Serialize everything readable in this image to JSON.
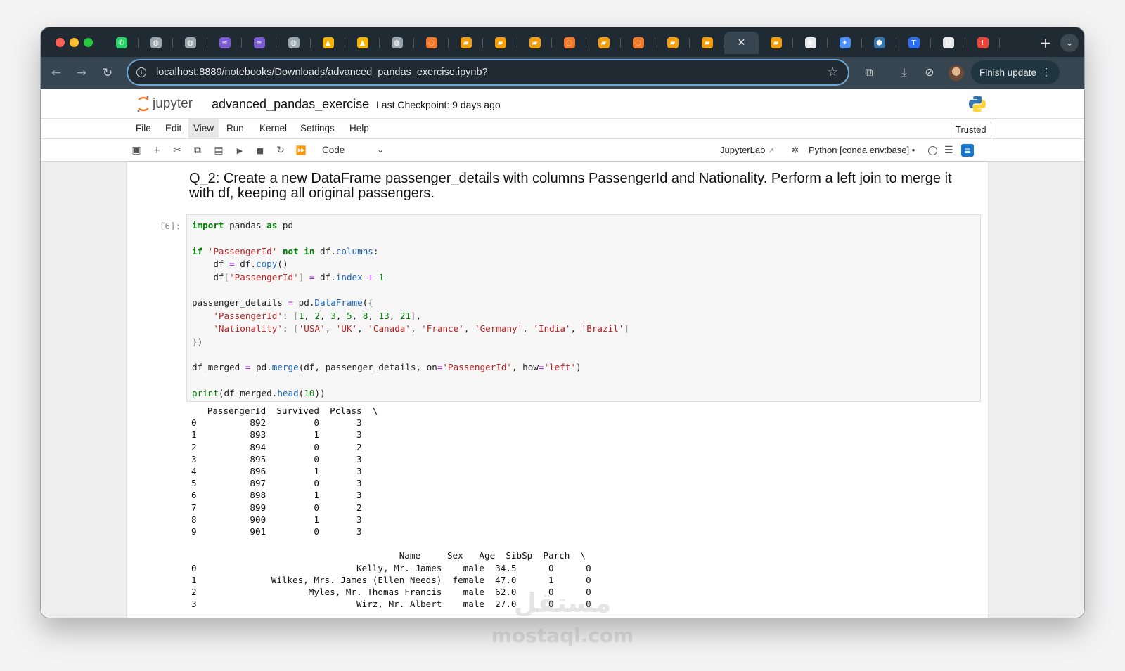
{
  "browser": {
    "url": "localhost:8889/notebooks/Downloads/advanced_pandas_exercise.ipynb?",
    "finish_update_label": "Finish update",
    "tabs": [
      {
        "icon": "whatsapp-icon",
        "color": "#25d366",
        "glyph": "✆"
      },
      {
        "icon": "globe-icon",
        "color": "#9aa6ae",
        "glyph": "◍"
      },
      {
        "icon": "globe-icon",
        "color": "#9aa6ae",
        "glyph": "◍"
      },
      {
        "icon": "list-icon",
        "color": "#7b5cd6",
        "glyph": "≡"
      },
      {
        "icon": "list-icon",
        "color": "#7b5cd6",
        "glyph": "≡"
      },
      {
        "icon": "globe-icon",
        "color": "#9aa6ae",
        "glyph": "◍"
      },
      {
        "icon": "drive-icon",
        "color": "#f4b400",
        "glyph": "▲"
      },
      {
        "icon": "drive-icon",
        "color": "#f4b400",
        "glyph": "▲"
      },
      {
        "icon": "globe-icon",
        "color": "#9aa6ae",
        "glyph": "◍"
      },
      {
        "icon": "jupyter-icon",
        "color": "#f37726",
        "glyph": "◌"
      },
      {
        "icon": "book-icon",
        "color": "#f59e0b",
        "glyph": "▰"
      },
      {
        "icon": "book-icon",
        "color": "#f59e0b",
        "glyph": "▰"
      },
      {
        "icon": "book-icon",
        "color": "#f59e0b",
        "glyph": "▰"
      },
      {
        "icon": "jupyter-icon",
        "color": "#f37726",
        "glyph": "◌"
      },
      {
        "icon": "book-icon",
        "color": "#f59e0b",
        "glyph": "▰"
      },
      {
        "icon": "jupyter-icon",
        "color": "#f37726",
        "glyph": "◌"
      },
      {
        "icon": "book-icon",
        "color": "#f59e0b",
        "glyph": "▰"
      },
      {
        "icon": "book-icon",
        "color": "#f59e0b",
        "glyph": "▰"
      },
      {
        "icon": "close-icon",
        "color": "#e8eaed",
        "glyph": "✕",
        "active": true
      },
      {
        "icon": "book-icon",
        "color": "#f59e0b",
        "glyph": "▰"
      },
      {
        "icon": "openai-icon",
        "color": "#e8eaed",
        "glyph": "❀"
      },
      {
        "icon": "gemini-icon",
        "color": "#4c8df6",
        "glyph": "✦"
      },
      {
        "icon": "python-icon",
        "color": "#3776ab",
        "glyph": "⬢"
      },
      {
        "icon": "t-icon",
        "color": "#2b6ef2",
        "glyph": "T"
      },
      {
        "icon": "u-icon",
        "color": "#e8eaed",
        "glyph": "U"
      },
      {
        "icon": "alert-icon",
        "color": "#e8453c",
        "glyph": "!"
      }
    ]
  },
  "jupyter": {
    "logo_text": "jupyter",
    "notebook_name": "advanced_pandas_exercise",
    "checkpoint": "Last Checkpoint: 9 days ago",
    "menu": [
      "File",
      "Edit",
      "View",
      "Run",
      "Kernel",
      "Settings",
      "Help"
    ],
    "active_menu": "View",
    "trusted_label": "Trusted",
    "cell_type": "Code",
    "jupyterlab_label": "JupyterLab",
    "kernel_name": "Python [conda env:base] •"
  },
  "notebook": {
    "markdown": "Q_2: Create a new DataFrame passenger_details with columns PassengerId and Nationality. Perform a left join to merge it with df, keeping all original passengers.",
    "prompt": "[6]:",
    "code_lines": [
      "import pandas as pd",
      "",
      "if 'PassengerId' not in df.columns:",
      "    df = df.copy()",
      "    df['PassengerId'] = df.index + 1",
      "",
      "passenger_details = pd.DataFrame({",
      "    'PassengerId': [1, 2, 3, 5, 8, 13, 21],",
      "    'Nationality': ['USA', 'UK', 'Canada', 'France', 'Germany', 'India', 'Brazil']",
      "})",
      "",
      "df_merged = pd.merge(df, passenger_details, on='PassengerId', how='left')",
      "",
      "print(df_merged.head(10))"
    ],
    "output_lines": [
      "   PassengerId  Survived  Pclass  \\",
      "0          892         0       3",
      "1          893         1       3",
      "2          894         0       2",
      "3          895         0       3",
      "4          896         1       3",
      "5          897         0       3",
      "6          898         1       3",
      "7          899         0       2",
      "8          900         1       3",
      "9          901         0       3",
      "",
      "                                       Name     Sex   Age  SibSp  Parch  \\",
      "0                              Kelly, Mr. James    male  34.5      0      0",
      "1              Wilkes, Mrs. James (Ellen Needs)  female  47.0      1      0",
      "2                     Myles, Mr. Thomas Francis    male  62.0      0      0",
      "3                              Wirz, Mr. Albert    male  27.0      0      0"
    ]
  },
  "watermark": {
    "arabic": "مستقل",
    "latin": "mostaql.com"
  }
}
